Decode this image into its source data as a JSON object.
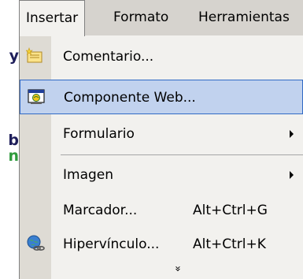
{
  "document_fragments": {
    "line1": "y",
    "line2": "b",
    "line3": "n"
  },
  "menubar": {
    "items": [
      {
        "label": "Insertar",
        "state": "open"
      },
      {
        "label": "Formato"
      },
      {
        "label": "Herramientas"
      }
    ]
  },
  "menu": {
    "items": [
      {
        "label": "Comentario...",
        "icon": "comment-icon"
      },
      {
        "label": "Componente Web...",
        "icon": "web-component-icon",
        "highlighted": true
      },
      {
        "label": "Formulario",
        "submenu": true
      },
      {
        "label": "Imagen",
        "submenu": true
      },
      {
        "label": "Marcador...",
        "shortcut": "Alt+Ctrl+G"
      },
      {
        "label": "Hipervínculo...",
        "shortcut": "Alt+Ctrl+K",
        "icon": "hyperlink-icon"
      }
    ],
    "expand_glyph": "»"
  },
  "colors": {
    "menubar_bg": "#d6d3ce",
    "menu_bg": "#f2f1ee",
    "gutter_bg": "#dedbd4",
    "highlight_bg": "#c1d2ee",
    "highlight_border": "#316ac5",
    "doc_text_green": "#2f9a3c",
    "doc_text_navy": "#1e1e5a"
  }
}
